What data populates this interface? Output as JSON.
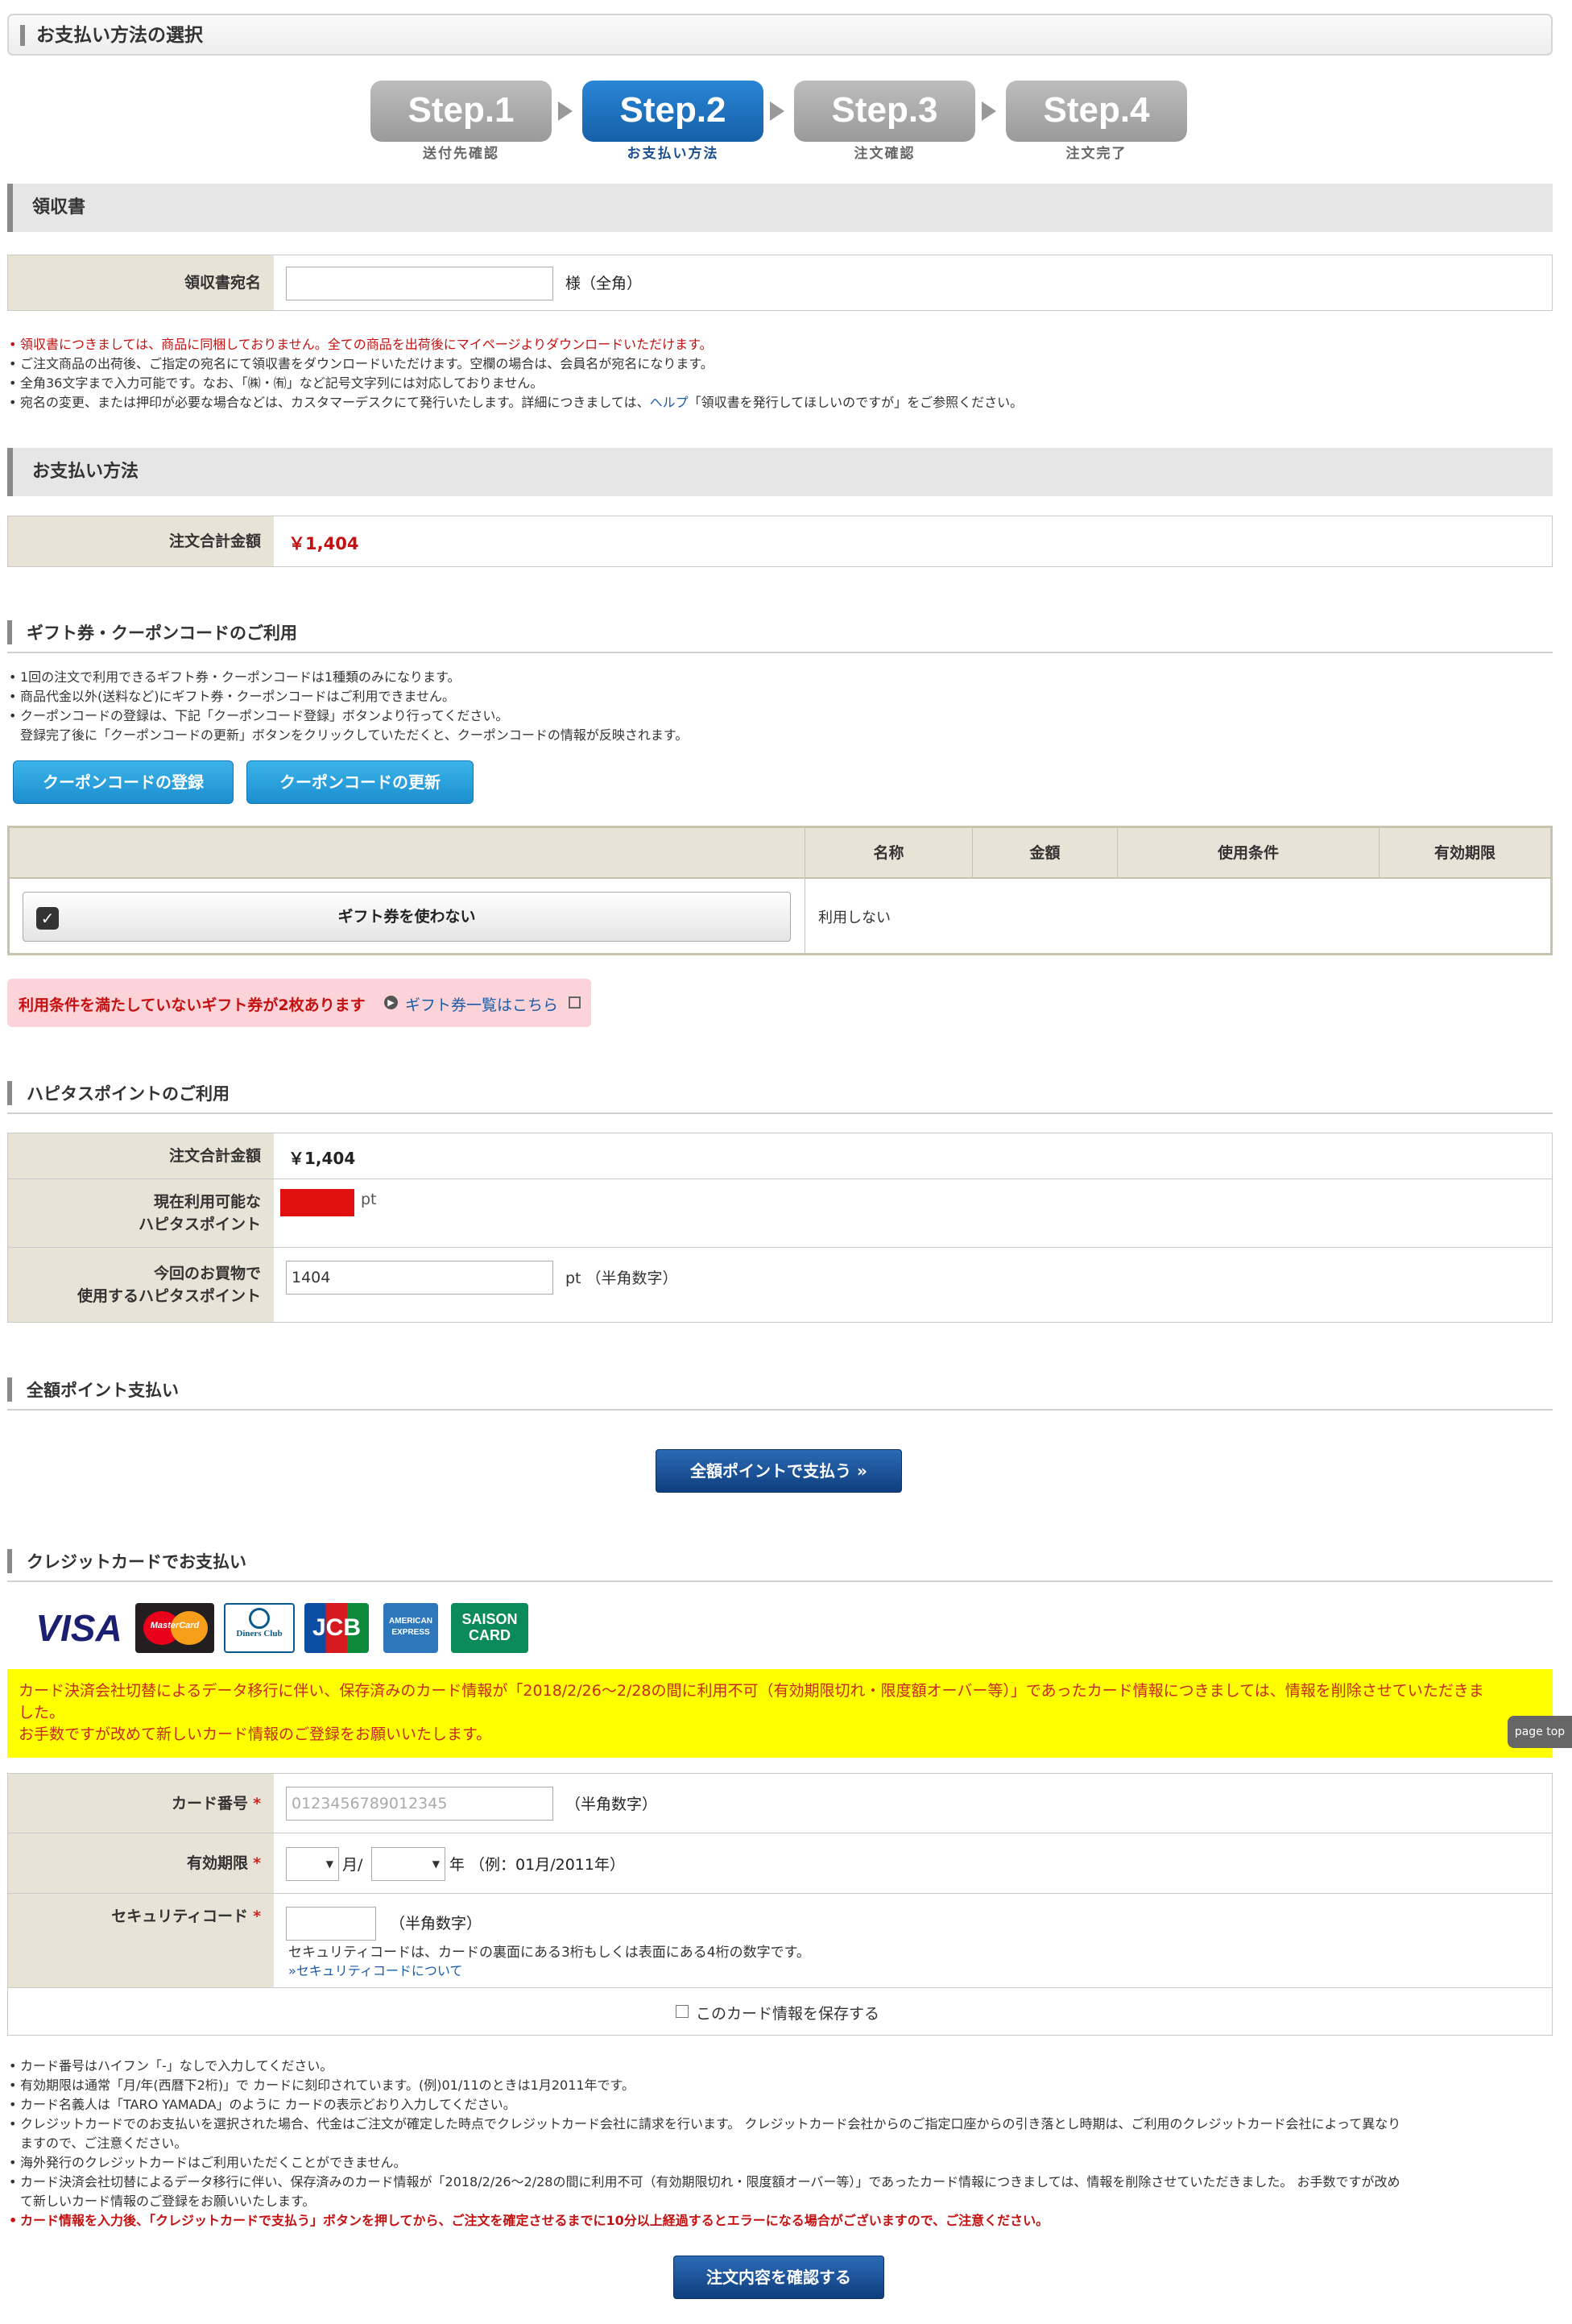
{
  "page_title": "お支払い方法の選択",
  "steps": [
    {
      "label": "Step.1",
      "caption": "送付先確認",
      "active": false
    },
    {
      "label": "Step.2",
      "caption": "お支払い方法",
      "active": true
    },
    {
      "label": "Step.3",
      "caption": "注文確認",
      "active": false
    },
    {
      "label": "Step.4",
      "caption": "注文完了",
      "active": false
    }
  ],
  "receipt": {
    "section_title": "領収書",
    "field_label": "領収書宛名",
    "field_value": "",
    "suffix": "様（全角）",
    "notes": [
      "領収書につきましては、商品に同梱しておりません。全ての商品を出荷後にマイページよりダウンロードいただけます。",
      "ご注文商品の出荷後、ご指定の宛名にて領収書をダウンロードいただけます。空欄の場合は、会員名が宛名になります。",
      "全角36文字まで入力可能です。なお、「㈱・㈲」など記号文字列には対応しておりません。",
      "宛名の変更、または押印が必要な場合などは、カスタマーデスクにて発行いたします。詳細につきましては、"
    ],
    "note4_link": "ヘルプ",
    "note4_tail": "「領収書を発行してほしいのですが」をご参照ください。"
  },
  "payment": {
    "section_title": "お支払い方法",
    "total_label": "注文合計金額",
    "total_value": "￥1,404"
  },
  "gift": {
    "title": "ギフト券・クーポンコードのご利用",
    "notes": [
      "1回の注文で利用できるギフト券・クーポンコードは1種類のみになります。",
      "商品代金以外(送料など)にギフト券・クーポンコードはご利用できません。",
      "クーポンコードの登録は、下記「クーポンコード登録」ボタンより行ってください。"
    ],
    "note_cont": "登録完了後に「クーポンコードの更新」ボタンをクリックしていただくと、クーポンコードの情報が反映されます。",
    "register_button": "クーポンコードの登録",
    "update_button": "クーポンコードの更新",
    "table_headers": [
      "名称",
      "金額",
      "使用条件",
      "有効期限"
    ],
    "no_use_button": "ギフト券を使わない",
    "no_use_text": "利用しない",
    "warning": "利用条件を満たしていないギフト券が2枚あります",
    "warning_link": "ギフト券一覧はこちら"
  },
  "points": {
    "title": "ハピタスポイントのご利用",
    "total_label": "注文合計金額",
    "total_value": "￥1,404",
    "available_label1": "現在利用可能な",
    "available_label2": "ハピタスポイント",
    "available_unit": "pt",
    "use_label1": "今回のお買物で",
    "use_label2": "使用するハピタスポイント",
    "use_value": "1404",
    "use_suffix": "pt （半角数字）"
  },
  "full_points": {
    "title": "全額ポイント支払い",
    "button": "全額ポイントで支払う »"
  },
  "credit": {
    "title": "クレジットカードでお支払い",
    "card_brands": [
      "VISA",
      "MasterCard",
      "Diners Club",
      "JCB",
      "AMERICAN EXPRESS",
      "SAISON CARD"
    ],
    "alert_line1": "カード決済会社切替によるデータ移行に伴い、保存済みのカード情報が「2018/2/26〜2/28の間に利用不可（有効期限切れ・限度額オーバー等）」であったカード情報につきましては、情報を削除させていただきま",
    "alert_line2": "した。",
    "alert_line3": "お手数ですが改めて新しいカード情報のご登録をお願いいたします。",
    "card_number_label": "カード番号",
    "card_number_placeholder": "0123456789012345",
    "card_number_hint": "（半角数字）",
    "expiry_label": "有効期限",
    "expiry_month_unit": "月/",
    "expiry_year_unit": "年 （例：01月/2011年）",
    "security_label": "セキュリティコード",
    "security_hint": "（半角数字）",
    "security_desc": "セキュリティコードは、カードの裏面にある3桁もしくは表面にある4桁の数字です。",
    "security_link": "»セキュリティコードについて",
    "save_card_label": "このカード情報を保存する",
    "required_mark": "*",
    "notes": [
      "カード番号はハイフン「-」なしで入力してください。",
      "有効期限は通常「月/年(西暦下2桁)」で カードに刻印されています。(例)01/11のときは1月2011年です。",
      "カード名義人は「TARO YAMADA」のように カードの表示どおり入力してください。",
      "クレジットカードでのお支払いを選択された場合、代金はご注文が確定した時点でクレジットカード会社に請求を行います。 クレジットカード会社からのご指定口座からの引き落とし時期は、ご利用のクレジットカード会社によって異なり",
      "海外発行のクレジットカードはご利用いただくことができません。",
      "カード決済会社切替によるデータ移行に伴い、保存済みのカード情報が「2018/2/26〜2/28の間に利用不可（有効期限切れ・限度額オーバー等）」であったカード情報につきましては、情報を削除させていただきました。 お手数ですが改め"
    ],
    "note4_cont": "ますので、ご注意ください。",
    "note6_cont": "て新しいカード情報のご登録をお願いいたします。",
    "note_red": "カード情報を入力後、「クレジットカードで支払う」ボタンを押してから、ご注文を確定させるまでに10分以上経過するとエラーになる場合がございますので、ご注意ください。",
    "confirm_button": "注文内容を確認する"
  },
  "page_top": "page top"
}
